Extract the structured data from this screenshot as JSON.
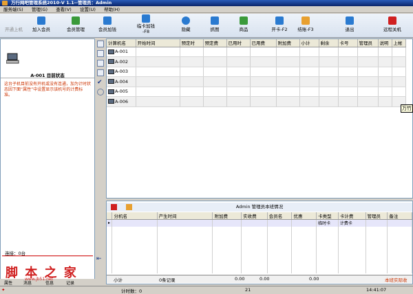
{
  "window": {
    "title": "万行网吧管理系统2010-V 1.1--管理员：Admin"
  },
  "menu": [
    "服务端(S)",
    "管理(G)",
    "查看(V)",
    "设置(U)",
    "帮助(H)"
  ],
  "toolbar": [
    {
      "label": "开通上机",
      "icon": "power-icon",
      "color": "#8a8a8a",
      "disabled": true
    },
    {
      "label": "加入会员",
      "icon": "add-member-icon",
      "color": "#2a7ad0"
    },
    {
      "label": "会员管理",
      "icon": "member-manage-icon",
      "color": "#3a9a3a"
    },
    {
      "label": "会员加钱",
      "icon": "add-money-icon",
      "color": "#2a7ad0"
    },
    {
      "label": "临卡加钱\n-F8",
      "icon": "temp-card-icon",
      "color": "#2a7ad0"
    },
    {
      "label": "隐藏",
      "icon": "hide-icon",
      "color": "#2a7ad0"
    },
    {
      "label": "抓图",
      "icon": "screenshot-icon",
      "color": "#2a7ad0"
    },
    {
      "label": "商品",
      "icon": "goods-icon",
      "color": "#3a9a3a"
    },
    {
      "label": "开卡-F2",
      "icon": "open-card-icon",
      "color": "#2a7ad0"
    },
    {
      "label": "结账-F3",
      "icon": "checkout-icon",
      "color": "#e8a030"
    },
    {
      "label": "退出",
      "icon": "exit-icon",
      "color": "#2a7ad0"
    },
    {
      "label": "远程关机",
      "icon": "remote-shutdown-icon",
      "color": "#d02020"
    }
  ],
  "left_panel": {
    "title": "A-001 目前状态",
    "description": "这台子机目前没有开机或没有连通，加为计时状态因下面“属性”中设置显示该机号的计费标准。",
    "connection": "连接：0台",
    "tabs": [
      "属性",
      "消息",
      "信息",
      "记录"
    ]
  },
  "main_grid": {
    "columns": [
      "计算机名",
      "开始时间",
      "预定时",
      "预定费",
      "已用时",
      "已用费",
      "附加费",
      "小计",
      "剩余",
      "卡号",
      "管理员",
      "说明",
      "上帐"
    ],
    "rows": [
      "A-001",
      "A-002",
      "A-003",
      "A-004",
      "A-005",
      "A-006"
    ],
    "tooltip": "万竹"
  },
  "bottom_panel": {
    "title": "Admin 管理员本班情况",
    "columns": [
      "分机名",
      "产生时间",
      "附加费",
      "实收费",
      "会员名",
      "优惠",
      "卡类型",
      "卡计费",
      "管理员",
      "备注"
    ],
    "subrow": {
      "card_type": "临时卡",
      "card_billing": "计费卡"
    },
    "summary": {
      "label": "小计",
      "records": "0条记录",
      "extra": "0.00",
      "received": "0.00",
      "discount": "0.00",
      "note": "本班实际收"
    }
  },
  "status": {
    "count": "计时数：0",
    "middle": "21",
    "time": "14:41:07"
  },
  "watermark": {
    "main": "脚 本 之 家",
    "url": "www.jb51.net"
  }
}
